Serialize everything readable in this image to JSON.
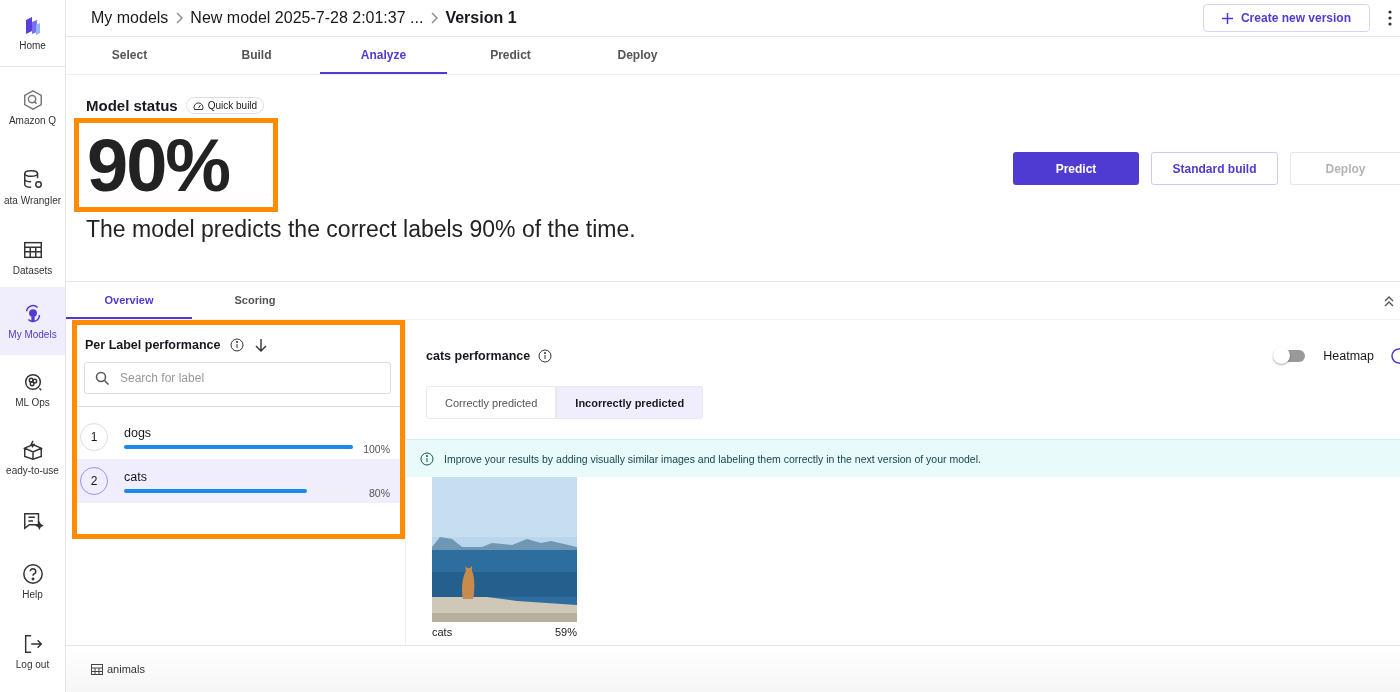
{
  "sidebar": {
    "items": [
      {
        "label": "Home",
        "selected": false
      },
      {
        "label": "Amazon Q",
        "selected": false
      },
      {
        "label": "ata Wrangler",
        "selected": false
      },
      {
        "label": "Datasets",
        "selected": false
      },
      {
        "label": "My Models",
        "selected": true
      },
      {
        "label": "ML Ops",
        "selected": false
      },
      {
        "label": "eady-to-use",
        "selected": false
      },
      {
        "selected": false
      },
      {
        "label": "Help",
        "selected": false
      },
      {
        "label": "Log out",
        "selected": false
      }
    ]
  },
  "breadcrumb": [
    "My models",
    "New model 2025-7-28 2:01:37 ...",
    "Version 1"
  ],
  "create_button": "Create new version",
  "tabs": [
    {
      "label": "Select",
      "selected": false
    },
    {
      "label": "Build",
      "selected": false
    },
    {
      "label": "Analyze",
      "selected": true
    },
    {
      "label": "Predict",
      "selected": false
    },
    {
      "label": "Deploy",
      "selected": false
    }
  ],
  "model_status": {
    "title": "Model status",
    "badge": "Quick build",
    "score": "90%",
    "score_highlighted": true,
    "summary": "The model predicts the correct labels 90% of the time.",
    "buttons": [
      {
        "label": "Predict",
        "kind": "primary",
        "disabled": false
      },
      {
        "label": "Standard build",
        "kind": "secondary",
        "disabled": false
      },
      {
        "label": "Deploy",
        "kind": "secondary",
        "disabled": true
      }
    ]
  },
  "subtabs": [
    {
      "label": "Overview",
      "selected": true
    },
    {
      "label": "Scoring",
      "selected": false
    }
  ],
  "label_panel": {
    "title": "Per Label performance",
    "highlighted": true,
    "search": {
      "placeholder": "Search for label"
    },
    "labels": [
      {
        "rank": "1",
        "name": "dogs",
        "level": 1.0,
        "reading": "100%",
        "selected": false
      },
      {
        "rank": "2",
        "name": "cats",
        "level": 0.8,
        "reading": "80%",
        "selected": true
      }
    ]
  },
  "detail": {
    "title": "cats performance",
    "heatmap": {
      "label": "Heatmap",
      "on": false
    },
    "segments": [
      {
        "label": "Correctly predicted",
        "selected": false
      },
      {
        "label": "Incorrectly predicted",
        "selected": true
      }
    ],
    "notice": "Improve your results by adding visually similar images and labeling them correctly in the next version of your model.",
    "images": [
      {
        "kind": "picture",
        "label": "cats",
        "score": "59%"
      }
    ]
  },
  "footer": {
    "dataset": "animals"
  }
}
